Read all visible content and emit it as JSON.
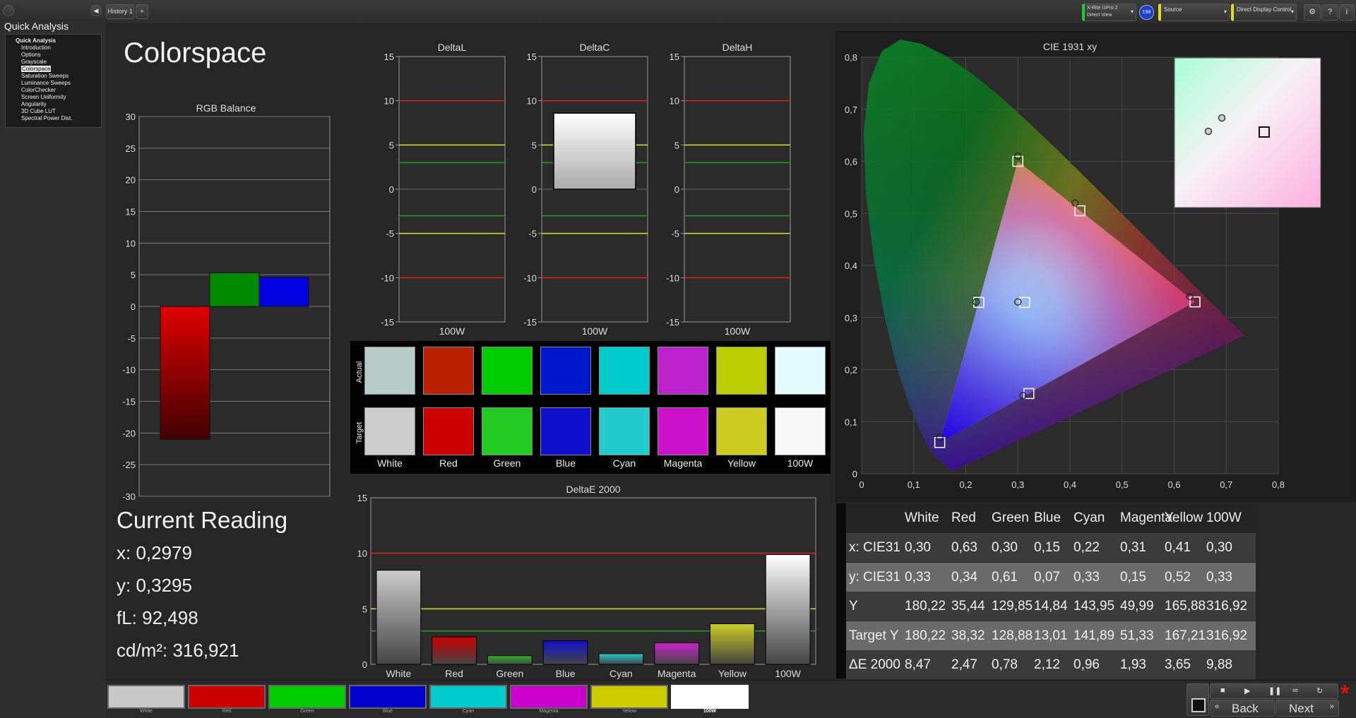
{
  "topbar": {
    "tab_label": "History 1",
    "add_tab": "+",
    "meter_line1": "X-Rite i1Pro 2",
    "meter_line2": "Direct View",
    "meter_badge": "198",
    "source_label": "Source",
    "display_label": "Direct Display Control"
  },
  "sidebar": {
    "title": "Quick Analysis",
    "items": [
      {
        "label": "Quick Analysis",
        "level": 0,
        "selected": false
      },
      {
        "label": "Introduction",
        "level": 1,
        "selected": false
      },
      {
        "label": "Options",
        "level": 1,
        "selected": false
      },
      {
        "label": "Grayscale",
        "level": 1,
        "selected": false
      },
      {
        "label": "Colorspace",
        "level": 1,
        "selected": true
      },
      {
        "label": "Saturation Sweeps",
        "level": 1,
        "selected": false
      },
      {
        "label": "Luminance Sweeps",
        "level": 1,
        "selected": false
      },
      {
        "label": "ColorChecker",
        "level": 1,
        "selected": false
      },
      {
        "label": "Screen Uniformity",
        "level": 1,
        "selected": false
      },
      {
        "label": "Angularity",
        "level": 1,
        "selected": false
      },
      {
        "label": "3D Cube LUT",
        "level": 1,
        "selected": false
      },
      {
        "label": "Spectral Power Dist.",
        "level": 1,
        "selected": false
      }
    ]
  },
  "page": {
    "title": "Colorspace"
  },
  "current_reading": {
    "title": "Current Reading",
    "x": "x: 0,2979",
    "y": "y: 0,3295",
    "fl": "fL: 92,498",
    "cdm2": "cd/m²: 316,921"
  },
  "chart_data": [
    {
      "type": "bar",
      "title": "RGB Balance",
      "categories": [
        "100W"
      ],
      "series": [
        {
          "color": "#e00000",
          "values": [
            -21
          ]
        },
        {
          "color": "#008a00",
          "values": [
            5.3
          ]
        },
        {
          "color": "#0000e0",
          "values": [
            4.6
          ]
        }
      ],
      "ylim": [
        -30,
        30
      ],
      "yticks": [
        "30",
        "25",
        "20",
        "15",
        "10",
        "5",
        "0",
        "-5",
        "-10",
        "-15",
        "-20",
        "-25",
        "-30"
      ]
    },
    {
      "type": "bar",
      "title": "DeltaL",
      "categories": [
        "100W"
      ],
      "values": [
        0
      ],
      "ylim": [
        -15,
        15
      ],
      "yticks": [
        "15",
        "10",
        "5",
        "0",
        "-5",
        "-10",
        "-15"
      ]
    },
    {
      "type": "bar",
      "title": "DeltaC",
      "categories": [
        "100W"
      ],
      "values": [
        8.6
      ],
      "ylim": [
        -15,
        15
      ],
      "yticks": [
        "15",
        "10",
        "5",
        "0",
        "-5",
        "-10",
        "-15"
      ]
    },
    {
      "type": "bar",
      "title": "DeltaH",
      "categories": [
        "100W"
      ],
      "values": [
        0
      ],
      "ylim": [
        -15,
        15
      ],
      "yticks": [
        "15",
        "10",
        "5",
        "0",
        "-5",
        "-10",
        "-15"
      ]
    },
    {
      "type": "bar",
      "title": "DeltaE 2000",
      "categories": [
        "White",
        "Red",
        "Green",
        "Blue",
        "Cyan",
        "Magenta",
        "Yellow",
        "100W"
      ],
      "values": [
        8.47,
        2.47,
        0.78,
        2.12,
        0.96,
        1.93,
        3.65,
        9.88
      ],
      "colors": [
        "#cccccc",
        "#cc0000",
        "#22bb22",
        "#1010cc",
        "#22cccc",
        "#cc22cc",
        "#cccc22",
        "#ffffff"
      ],
      "ylim": [
        0,
        15
      ],
      "yticks": [
        "15",
        "10",
        "5",
        "0"
      ]
    },
    {
      "type": "scatter",
      "title": "CIE 1931 xy",
      "xlim": [
        0,
        0.8
      ],
      "ylim": [
        0,
        0.8
      ],
      "xticks": [
        "0",
        "0,1",
        "0,2",
        "0,3",
        "0,4",
        "0,5",
        "0,6",
        "0,7",
        "0,8"
      ],
      "yticks": [
        "0",
        "0,1",
        "0,2",
        "0,3",
        "0,4",
        "0,5",
        "0,6",
        "0,7",
        "0,8"
      ],
      "targets": [
        {
          "name": "White",
          "x": 0.313,
          "y": 0.329
        },
        {
          "name": "Red",
          "x": 0.64,
          "y": 0.33
        },
        {
          "name": "Green",
          "x": 0.3,
          "y": 0.6
        },
        {
          "name": "Blue",
          "x": 0.15,
          "y": 0.06
        },
        {
          "name": "Cyan",
          "x": 0.225,
          "y": 0.329
        },
        {
          "name": "Magenta",
          "x": 0.321,
          "y": 0.154
        },
        {
          "name": "Yellow",
          "x": 0.419,
          "y": 0.505
        }
      ],
      "measured": [
        {
          "name": "White",
          "x": 0.3,
          "y": 0.33
        },
        {
          "name": "Red",
          "x": 0.63,
          "y": 0.34
        },
        {
          "name": "Green",
          "x": 0.3,
          "y": 0.61
        },
        {
          "name": "Blue",
          "x": 0.15,
          "y": 0.07
        },
        {
          "name": "Cyan",
          "x": 0.22,
          "y": 0.33
        },
        {
          "name": "Magenta",
          "x": 0.31,
          "y": 0.15
        },
        {
          "name": "Yellow",
          "x": 0.41,
          "y": 0.52
        }
      ]
    }
  ],
  "swatch_panel": {
    "actual_label": "Actual",
    "target_label": "Target",
    "swatches": [
      {
        "label": "White",
        "actual": "#b8ccc8",
        "target": "#cccccc"
      },
      {
        "label": "Red",
        "actual": "#bb2000",
        "target": "#cc0000"
      },
      {
        "label": "Green",
        "actual": "#00cc00",
        "target": "#22cc22"
      },
      {
        "label": "Blue",
        "actual": "#0018cc",
        "target": "#1010cc"
      },
      {
        "label": "Cyan",
        "actual": "#00cccc",
        "target": "#22cccc"
      },
      {
        "label": "Magenta",
        "actual": "#bb22cc",
        "target": "#cc11cc"
      },
      {
        "label": "Yellow",
        "actual": "#bbcc00",
        "target": "#cccc22"
      },
      {
        "label": "100W",
        "actual": "#e4fbff",
        "target": "#f8f8f8"
      }
    ]
  },
  "table": {
    "headers": [
      "",
      "White",
      "Red",
      "Green",
      "Blue",
      "Cyan",
      "Magenta",
      "Yellow",
      "100W"
    ],
    "rows": [
      [
        "x: CIE31",
        "0,30",
        "0,63",
        "0,30",
        "0,15",
        "0,22",
        "0,31",
        "0,41",
        "0,30"
      ],
      [
        "y: CIE31",
        "0,33",
        "0,34",
        "0,61",
        "0,07",
        "0,33",
        "0,15",
        "0,52",
        "0,33"
      ],
      [
        "Y",
        "180,22",
        "35,44",
        "129,85",
        "14,84",
        "143,95",
        "49,99",
        "165,88",
        "316,92"
      ],
      [
        "Target Y",
        "180,22",
        "38,32",
        "128,88",
        "13,01",
        "141,89",
        "51,33",
        "167,21",
        "316,92"
      ],
      [
        "ΔE 2000",
        "8,47",
        "2,47",
        "0,78",
        "2,12",
        "0,96",
        "1,93",
        "3,65",
        "9,88"
      ]
    ]
  },
  "bottombar": {
    "swatches": [
      {
        "label": "White",
        "color": "#c8c8c8"
      },
      {
        "label": "Red",
        "color": "#cc0000"
      },
      {
        "label": "Green",
        "color": "#00cc00"
      },
      {
        "label": "Blue",
        "color": "#0000cc"
      },
      {
        "label": "Cyan",
        "color": "#00cccc"
      },
      {
        "label": "Magenta",
        "color": "#cc00cc"
      },
      {
        "label": "Yellow",
        "color": "#cccc00"
      },
      {
        "label": "100W",
        "color": "#ffffff"
      }
    ],
    "back_label": "Back",
    "next_label": "Next"
  }
}
